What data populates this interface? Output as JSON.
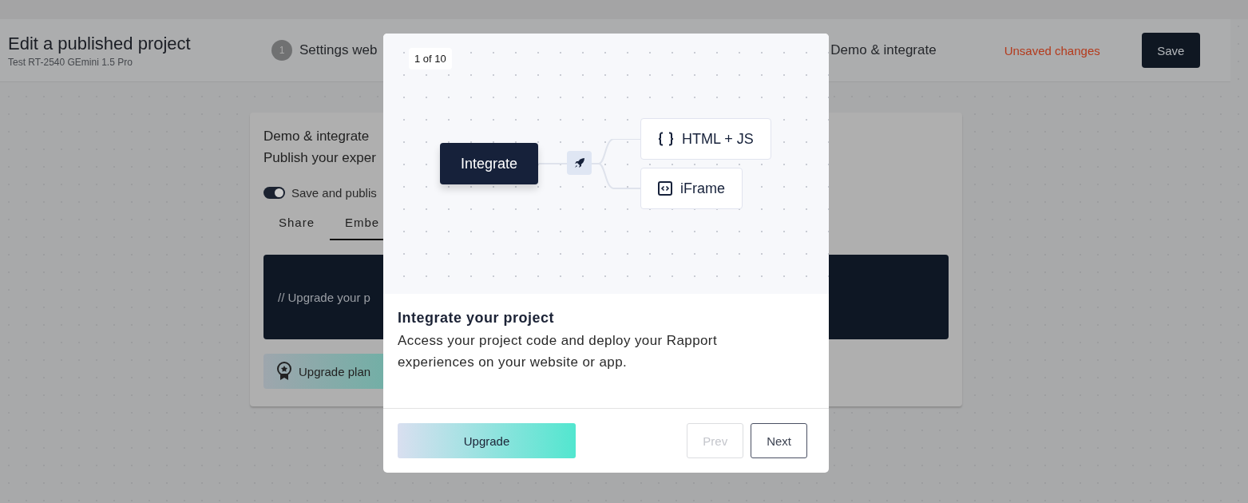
{
  "header": {
    "title": "Edit a published project",
    "subtitle": "Test RT-2540 GEmini 1.5 Pro"
  },
  "steps": [
    {
      "number": "1",
      "label": "Settings web"
    },
    {
      "label": "Demo & integrate"
    }
  ],
  "status": "Unsaved changes",
  "save_button": "Save",
  "card": {
    "title": "Demo & integrate",
    "subtitle": "Publish your exper",
    "toggle": {
      "label": "Save and publis",
      "on": true
    },
    "tabs": [
      {
        "label": "Share",
        "selected": false
      },
      {
        "label": "Embe",
        "selected": true
      }
    ],
    "code": "// Upgrade your p",
    "upgrade_button": "Upgrade plan"
  },
  "modal": {
    "counter": "1 of 10",
    "diagram": {
      "root": "Integrate",
      "branches": [
        {
          "kind": "code",
          "label": "HTML + JS"
        },
        {
          "kind": "frame",
          "label": "iFrame"
        }
      ]
    },
    "title": "Integrate your project",
    "description": "Access your project code and deploy your Rapport experiences on your website or app.",
    "primary_button": "Upgrade",
    "prev": {
      "label": "Prev",
      "disabled": true
    },
    "next": {
      "label": "Next",
      "disabled": false
    }
  }
}
